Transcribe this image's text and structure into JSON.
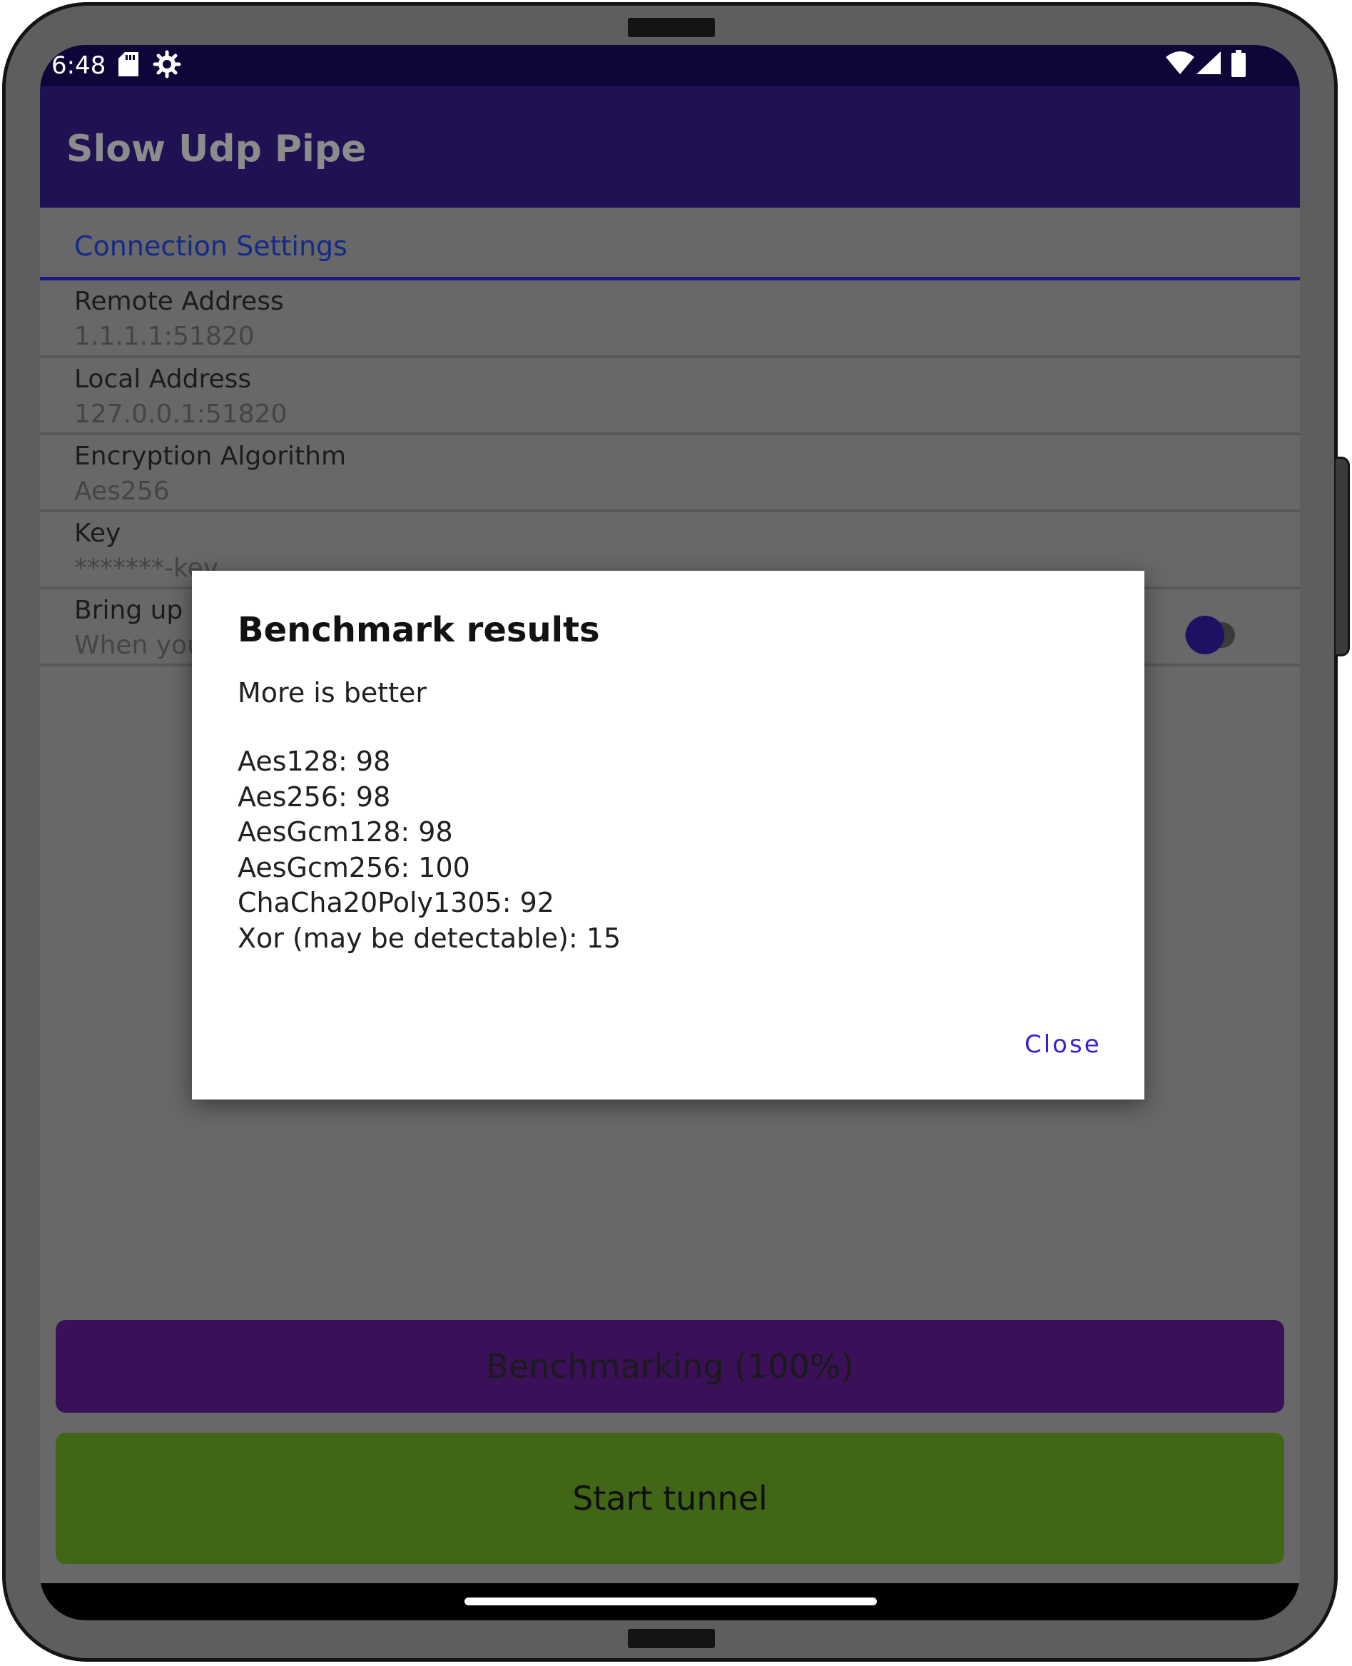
{
  "status_bar": {
    "time": "6:48",
    "icons": [
      "sd-card-icon",
      "gear-icon",
      "wifi-icon",
      "signal-icon",
      "battery-icon"
    ]
  },
  "app_bar": {
    "title": "Slow Udp Pipe"
  },
  "settings": {
    "section_label": "Connection Settings",
    "items": [
      {
        "title": "Remote Address",
        "value": "1.1.1.1:51820"
      },
      {
        "title": "Local Address",
        "value": "127.0.0.1:51820"
      },
      {
        "title": "Encryption Algorithm",
        "value": "Aes256"
      },
      {
        "title": "Key",
        "value": "*******-key"
      },
      {
        "title": "Bring up u",
        "value": "When you"
      }
    ]
  },
  "buttons": {
    "benchmark_label": "Benchmarking (100%)",
    "start_label": "Start tunnel"
  },
  "dialog": {
    "title": "Benchmark results",
    "subtitle": "More is better",
    "results": [
      "Aes128: 98",
      "Aes256: 98",
      "AesGcm128: 98",
      "AesGcm256: 100",
      "ChaCha20Poly1305: 92",
      "Xor (may be detectable): 15"
    ],
    "close_label": "Close"
  },
  "colors": {
    "status_bar": "#0e0538",
    "app_bar": "#1f1152",
    "accent": "#1e1063",
    "benchmark_button": "#3a1158",
    "start_button": "#416615",
    "dialog_action": "#3d1ed0"
  }
}
